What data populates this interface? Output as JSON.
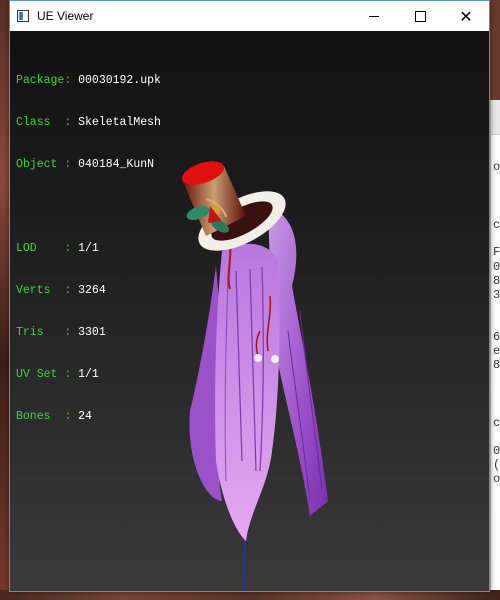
{
  "window": {
    "title": "UE Viewer"
  },
  "controls": {
    "minimize": "—",
    "maximize": "☐",
    "close": "✕"
  },
  "info_block_1": [
    {
      "label": "Package",
      "sep": ": ",
      "value": "00030192.upk"
    },
    {
      "label": "Class  ",
      "sep": ": ",
      "value": "SkeletalMesh"
    },
    {
      "label": "Object ",
      "sep": ": ",
      "value": "040184_KunN"
    }
  ],
  "info_block_2": [
    {
      "label": "LOD    ",
      "sep": ": ",
      "value": "1/1"
    },
    {
      "label": "Verts  ",
      "sep": ": ",
      "value": "3264"
    },
    {
      "label": "Tris   ",
      "sep": ": ",
      "value": "3301"
    },
    {
      "label": "UV Set ",
      "sep": ": ",
      "value": "1/1"
    },
    {
      "label": "Bones  ",
      "sep": ": ",
      "value": "24"
    }
  ],
  "background_window_chars": [
    "o",
    "c",
    "F",
    "0",
    "8",
    "3",
    "6",
    "e",
    "8",
    "c",
    "0",
    "(",
    "o"
  ],
  "colors": {
    "label_green": "#38d838",
    "value_white": "#ffffff",
    "hat_red": "#e01010",
    "fur_white": "#f2eee8",
    "hair_purple": "#b266d6",
    "axis_blue": "#1f2fd0"
  },
  "icons": {
    "app": "app-window-icon"
  }
}
